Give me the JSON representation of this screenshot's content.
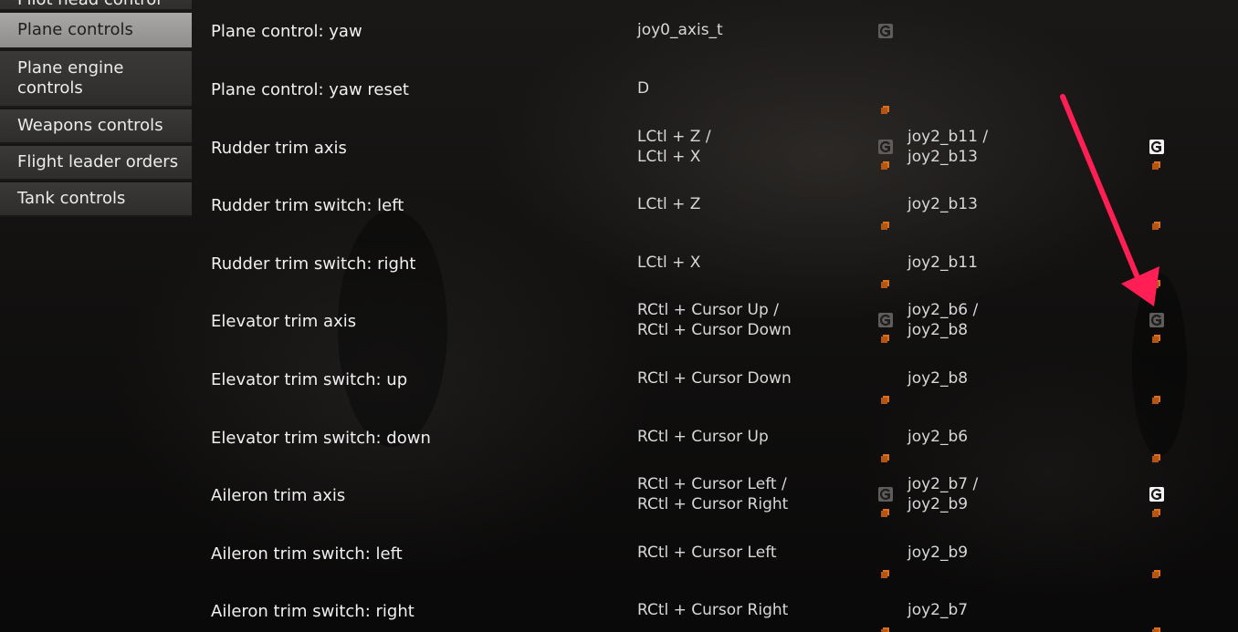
{
  "sidebar": {
    "items": [
      {
        "label": "Pilot head control"
      },
      {
        "label": "Plane controls",
        "active": true
      },
      {
        "label": "Plane engine controls"
      },
      {
        "label": "Weapons controls"
      },
      {
        "label": "Flight leader orders"
      },
      {
        "label": "Tank controls"
      }
    ]
  },
  "rows": [
    {
      "label": "Plane control: yaw",
      "key1": "joy0_axis_t",
      "key2": "",
      "reset1": "dim",
      "reset2": ""
    },
    {
      "label": "Plane control: yaw reset",
      "key1": "D",
      "key2": "",
      "reset1": "",
      "reset2": ""
    },
    {
      "label": "Rudder trim axis",
      "key1": "LCtl + Z /\nLCtl + X",
      "key2": "joy2_b11 /\njoy2_b13",
      "reset1": "dim",
      "reset2": "bright"
    },
    {
      "label": "Rudder trim switch: left",
      "key1": "LCtl + Z",
      "key2": "joy2_b13",
      "reset1": "",
      "reset2": ""
    },
    {
      "label": "Rudder trim switch: right",
      "key1": "LCtl + X",
      "key2": "joy2_b11",
      "reset1": "",
      "reset2": ""
    },
    {
      "label": "Elevator trim axis",
      "key1": "RCtl + Cursor Up /\nRCtl + Cursor Down",
      "key2": "joy2_b6 /\njoy2_b8",
      "reset1": "dim",
      "reset2": "dim"
    },
    {
      "label": "Elevator trim switch: up",
      "key1": "RCtl + Cursor Down",
      "key2": "joy2_b8",
      "reset1": "",
      "reset2": ""
    },
    {
      "label": "Elevator trim switch: down",
      "key1": "RCtl + Cursor Up",
      "key2": "joy2_b6",
      "reset1": "",
      "reset2": ""
    },
    {
      "label": "Aileron trim axis",
      "key1": "RCtl + Cursor Left /\nRCtl + Cursor Right",
      "key2": "joy2_b7 /\njoy2_b9",
      "reset1": "dim",
      "reset2": "bright"
    },
    {
      "label": "Aileron trim switch: left",
      "key1": "RCtl + Cursor Left",
      "key2": "joy2_b9",
      "reset1": "",
      "reset2": ""
    },
    {
      "label": "Aileron trim switch: right",
      "key1": "RCtl + Cursor Right",
      "key2": "joy2_b7",
      "reset1": "",
      "reset2": ""
    }
  ],
  "icons": {
    "reset": "axis-reset-icon",
    "binding_marker": "binding-marker-icon",
    "annotation": "red-arrow-annotation"
  },
  "colors": {
    "accent_orange": "#d9701f",
    "annotation_red": "#ff1f55",
    "active_tab": "#a9a8a6",
    "sidebar_item": "#363534"
  }
}
